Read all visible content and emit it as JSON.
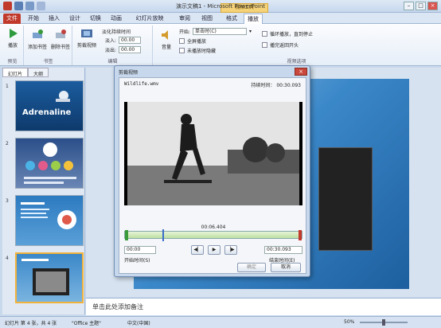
{
  "window": {
    "title": "演示文稿1 - Microsoft PowerPoint",
    "context_tab": "视频工具"
  },
  "tabs": [
    "文件",
    "开始",
    "插入",
    "设计",
    "切换",
    "动画",
    "幻灯片放映",
    "审阅",
    "视图",
    "格式",
    "播放"
  ],
  "ribbon": {
    "preview": {
      "play_label": "播放",
      "group": "预览"
    },
    "bookmark": {
      "add_label": "添加书签",
      "remove_label": "删除书签",
      "group": "书签"
    },
    "edit": {
      "trim_label": "剪裁视频",
      "fade_label": "淡化持续时间",
      "fade_in_label": "淡入:",
      "fade_in_value": "00.00",
      "fade_out_label": "淡出:",
      "fade_out_value": "00.00",
      "group": "编辑"
    },
    "options": {
      "volume_label": "音量",
      "start_label": "开始:",
      "start_value": "单击时(C)",
      "fullscreen_label": "全屏播放",
      "hide_label": "未播放时隐藏",
      "loop_label": "循环播放，直到停止",
      "rewind_label": "播完返回开头",
      "group": "视频选项"
    }
  },
  "pane": {
    "tab_slides": "幻灯片",
    "tab_outline": "大纲",
    "slide_numbers": [
      "1",
      "2",
      "3",
      "4"
    ],
    "slide1_title": "Adrenaline"
  },
  "dialog": {
    "title": "剪裁视频",
    "filename": "Wildlife.wmv",
    "duration_label": "持续时间：",
    "duration_value": "00:30.093",
    "current_time": "00:06.404",
    "start_value": "00:00",
    "start_label": "开始时间(S)",
    "end_value": "00:30.093",
    "end_label": "结束时间(E)",
    "ok_label": "确定",
    "cancel_label": "取消",
    "playhead_fraction": 0.21
  },
  "notes": {
    "placeholder": "单击此处添加备注"
  },
  "status": {
    "slide_info": "幻灯片 第 4 张，共 4 张",
    "theme": "\"Office 主题\"",
    "language": "中文(中国)",
    "zoom": "50%"
  }
}
